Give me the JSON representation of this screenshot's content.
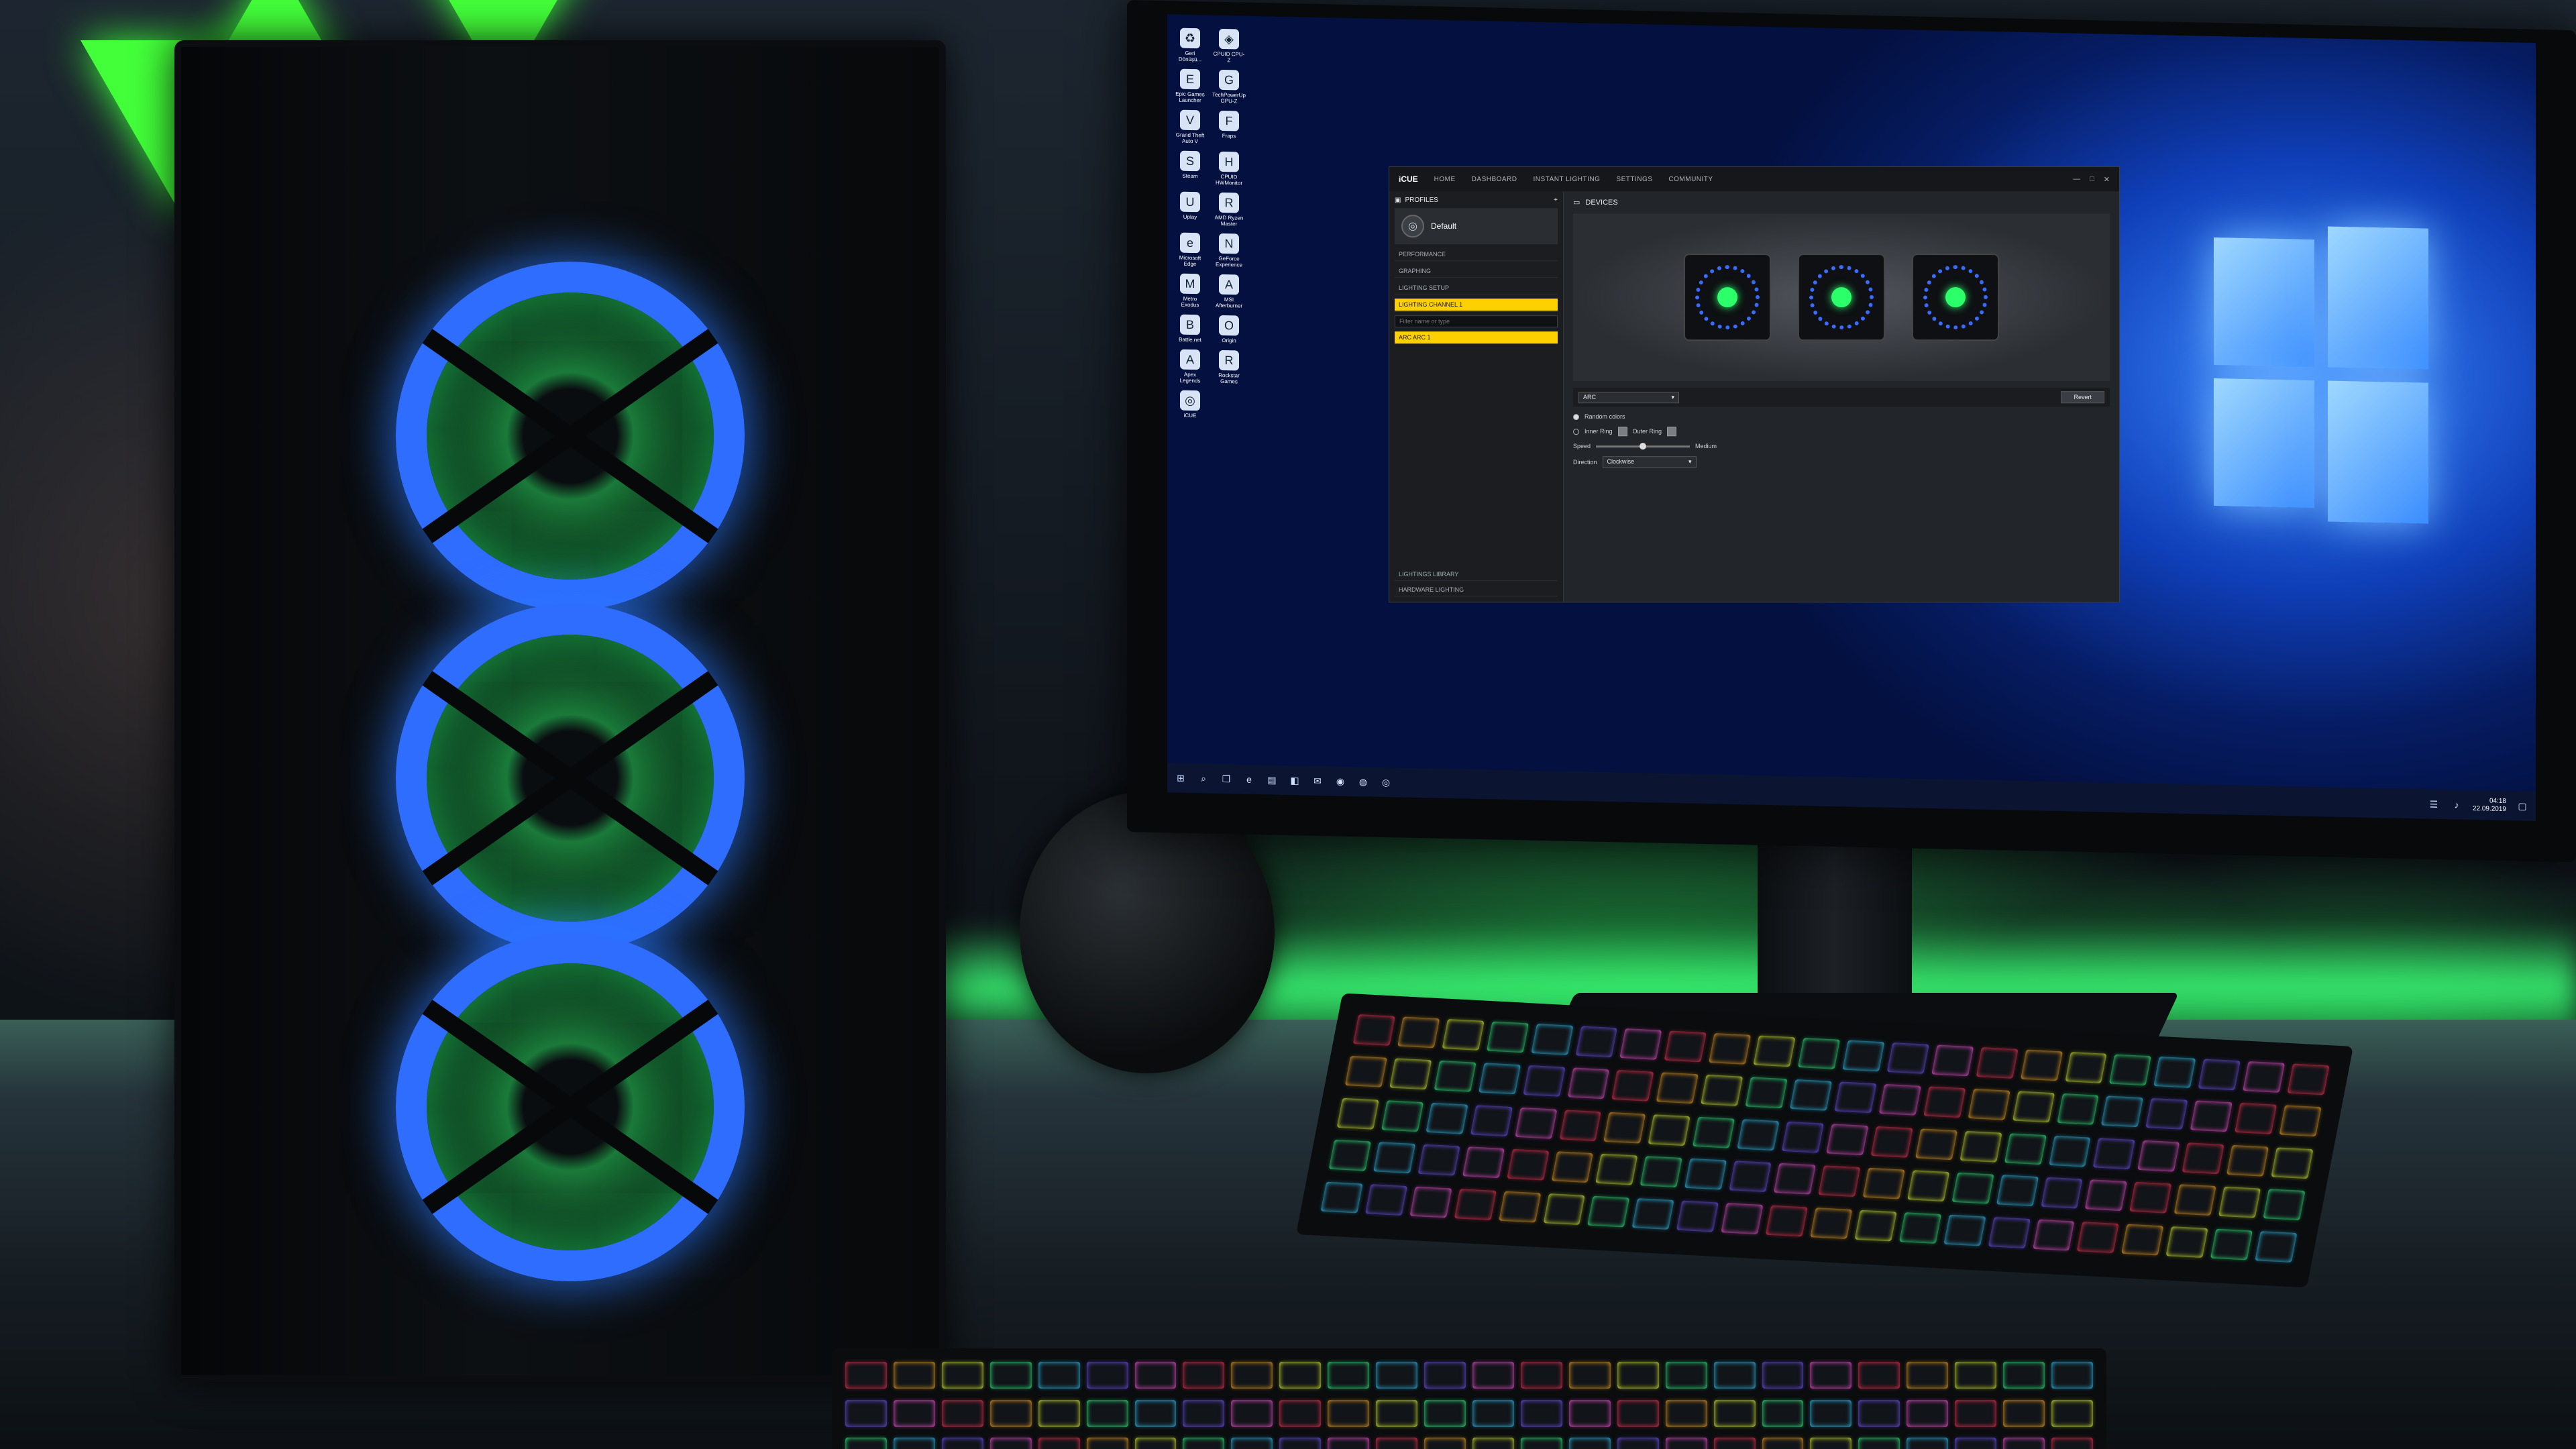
{
  "desktop": {
    "icons": [
      {
        "label": "Geri Dönüşü...",
        "icon": "recycle-bin-icon",
        "glyph": "♻"
      },
      {
        "label": "CPUID CPU-Z",
        "icon": "cpuz-icon",
        "glyph": "◈"
      },
      {
        "label": "Epic Games Launcher",
        "icon": "epic-icon",
        "glyph": "E"
      },
      {
        "label": "TechPowerUp GPU-Z",
        "icon": "gpuz-icon",
        "glyph": "G"
      },
      {
        "label": "Grand Theft Auto V",
        "icon": "gta-icon",
        "glyph": "V"
      },
      {
        "label": "Fraps",
        "icon": "fraps-icon",
        "glyph": "F"
      },
      {
        "label": "Steam",
        "icon": "steam-icon",
        "glyph": "S"
      },
      {
        "label": "CPUID HWMonitor",
        "icon": "hwmonitor-icon",
        "glyph": "H"
      },
      {
        "label": "Uplay",
        "icon": "uplay-icon",
        "glyph": "U"
      },
      {
        "label": "AMD Ryzen Master",
        "icon": "ryzen-icon",
        "glyph": "R"
      },
      {
        "label": "Microsoft Edge",
        "icon": "edge-icon",
        "glyph": "e"
      },
      {
        "label": "GeForce Experience",
        "icon": "geforce-icon",
        "glyph": "N"
      },
      {
        "label": "Metro Exodus",
        "icon": "metro-icon",
        "glyph": "M"
      },
      {
        "label": "MSI Afterburner",
        "icon": "afterburner-icon",
        "glyph": "A"
      },
      {
        "label": "Battle.net",
        "icon": "battlenet-icon",
        "glyph": "B"
      },
      {
        "label": "Origin",
        "icon": "origin-icon",
        "glyph": "O"
      },
      {
        "label": "Apex Legends",
        "icon": "apex-icon",
        "glyph": "A"
      },
      {
        "label": "Rockstar Games",
        "icon": "rockstar-icon",
        "glyph": "R"
      },
      {
        "label": "iCUE",
        "icon": "icue-icon",
        "glyph": "◎"
      }
    ]
  },
  "taskbar": {
    "start_icon": "windows-start-icon",
    "time": "04:18",
    "date": "22.09.2019"
  },
  "icue": {
    "brand": "iCUE",
    "nav": [
      "HOME",
      "DASHBOARD",
      "INSTANT LIGHTING",
      "SETTINGS",
      "COMMUNITY"
    ],
    "window_buttons": [
      "—",
      "□",
      "✕"
    ],
    "profiles_label": "PROFILES",
    "profile_name": "Default",
    "menu": [
      "PERFORMANCE",
      "GRAPHING",
      "LIGHTING SETUP"
    ],
    "channel_label": "LIGHTING CHANNEL 1",
    "filter_placeholder": "Filter name or type",
    "effect_item": "ARC ARC 1",
    "library_label": "LIGHTINGS LIBRARY",
    "hardware_label": "HARDWARE LIGHTING",
    "devices_label": "DEVICES",
    "effect_selected": "ARC",
    "revert_label": "Revert",
    "random_colors_label": "Random colors",
    "inner_ring_label": "Inner Ring",
    "outer_ring_label": "Outer Ring",
    "speed_label": "Speed",
    "speed_value_label": "Medium",
    "speed_level": 0.5,
    "direction_label": "Direction",
    "direction_value": "Clockwise"
  }
}
